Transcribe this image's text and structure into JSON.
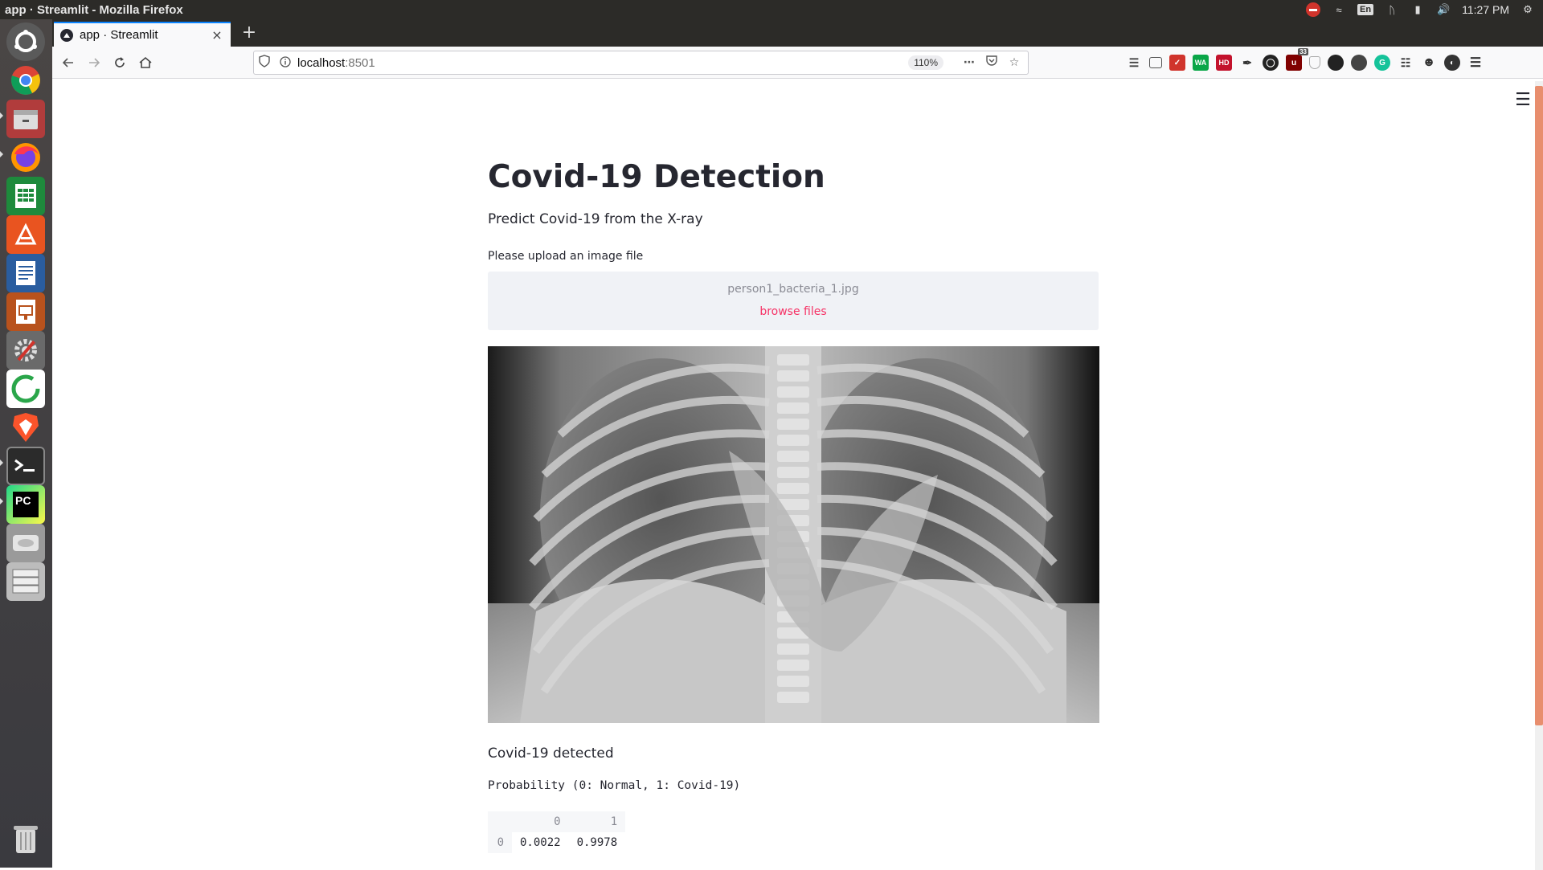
{
  "window": {
    "title": "app · Streamlit - Mozilla Firefox"
  },
  "system_tray": {
    "keyboard_layout": "En",
    "clock": "11:27 PM"
  },
  "launcher": {
    "items": [
      {
        "name": "ubuntu-dash-icon",
        "color": "#595959"
      },
      {
        "name": "chrome-icon",
        "color": "#d7d7d7"
      },
      {
        "name": "files-icon",
        "color": "#9b3b3b"
      },
      {
        "name": "firefox-icon",
        "color": "#e66000"
      },
      {
        "name": "calc-icon",
        "color": "#1e8a3c"
      },
      {
        "name": "software-center-icon",
        "color": "#e95420"
      },
      {
        "name": "writer-icon",
        "color": "#2a5d9f"
      },
      {
        "name": "impress-icon",
        "color": "#b8521d"
      },
      {
        "name": "settings-icon",
        "color": "#6a6a6a"
      },
      {
        "name": "circle-app-icon",
        "color": "#ffffff"
      },
      {
        "name": "brave-icon",
        "color": "#fb542b"
      },
      {
        "name": "terminal-icon",
        "color": "#2b2b2b"
      },
      {
        "name": "pycharm-icon",
        "color": "#21d789"
      },
      {
        "name": "disk-icon",
        "color": "#9a9a9a"
      },
      {
        "name": "storage-icon",
        "color": "#bcbcbc"
      },
      {
        "name": "trash-icon",
        "color": "#9a9a9a"
      }
    ],
    "pycharm_label": "PC"
  },
  "browser": {
    "tab": {
      "title": "app · Streamlit",
      "close": "×"
    },
    "new_tab": "+",
    "url_host": "localhost",
    "url_port": ":8501",
    "zoom": "110%",
    "extension_badge": "33",
    "ext_wa": "WA",
    "ext_hd": "HD"
  },
  "app": {
    "title": "Covid-19 Detection",
    "subtitle": "Predict Covid-19 from the X-ray",
    "upload_label": "Please upload an image file",
    "uploaded_file": "person1_bacteria_1.jpg",
    "browse_label": "browse files",
    "result": "Covid-19 detected",
    "probability_label": "Probability (0: Normal, 1: Covid-19)",
    "table": {
      "columns": [
        "",
        "0",
        "1"
      ],
      "rows": [
        {
          "index": "0",
          "values": [
            "0.0022",
            "0.9978"
          ]
        }
      ]
    }
  }
}
